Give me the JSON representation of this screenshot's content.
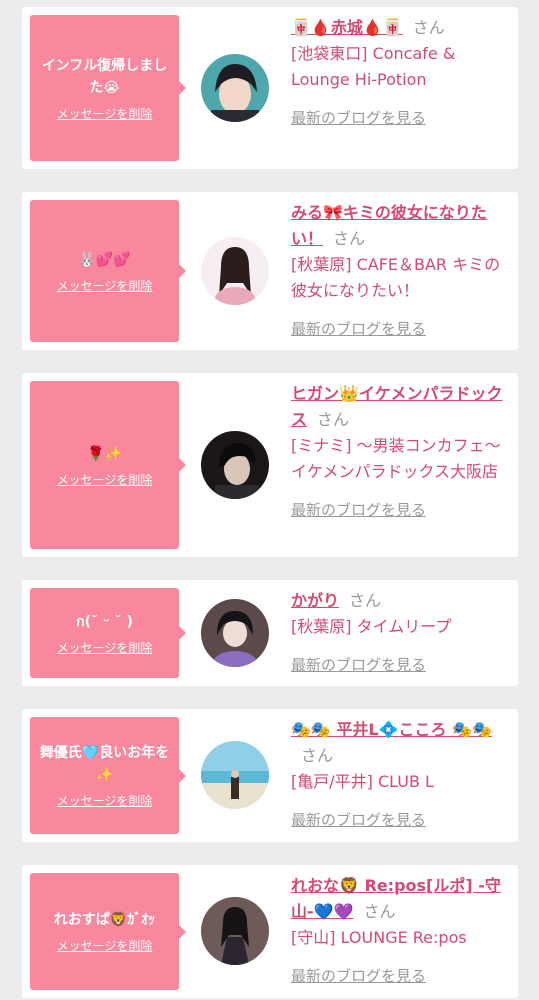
{
  "delete_label": "メッセージを削除",
  "blog_label": "最新のブログを見る",
  "honorific": "さん",
  "cards": [
    {
      "message": "インフル復帰しました😭",
      "name": "🀄🩸赤城🩸🀄",
      "shop": "[池袋東口] Concafe & Lounge Hi-Potion"
    },
    {
      "message": "🐰💕💕",
      "name": "みる🎀キミの彼女になりたい！",
      "shop": "[秋葉原] CAFE＆BAR キミの彼女になりたい！"
    },
    {
      "message": "🌹✨",
      "name": "ヒガン👑イケメンパラドックス",
      "shop": "[ミナミ] 〜男装コンカフェ〜イケメンパラドックス大阪店"
    },
    {
      "message": "ก(˘ ᵕ ˘ )",
      "name": "かがり",
      "shop": "[秋葉原] タイムリープ"
    },
    {
      "message": "舞優氏🩵良いお年を✨",
      "name": "🎭🎭 平井L💠こころ 🎭🎭",
      "shop": "[亀戸/平井] CLUB L"
    },
    {
      "message": "れおすぱ🦁ｶﾞｵｯ",
      "name": "れおな🦁 Re:pos[ルポ] -守山-💙💜",
      "shop": "[守山] LOUNGE Re:pos"
    }
  ]
}
